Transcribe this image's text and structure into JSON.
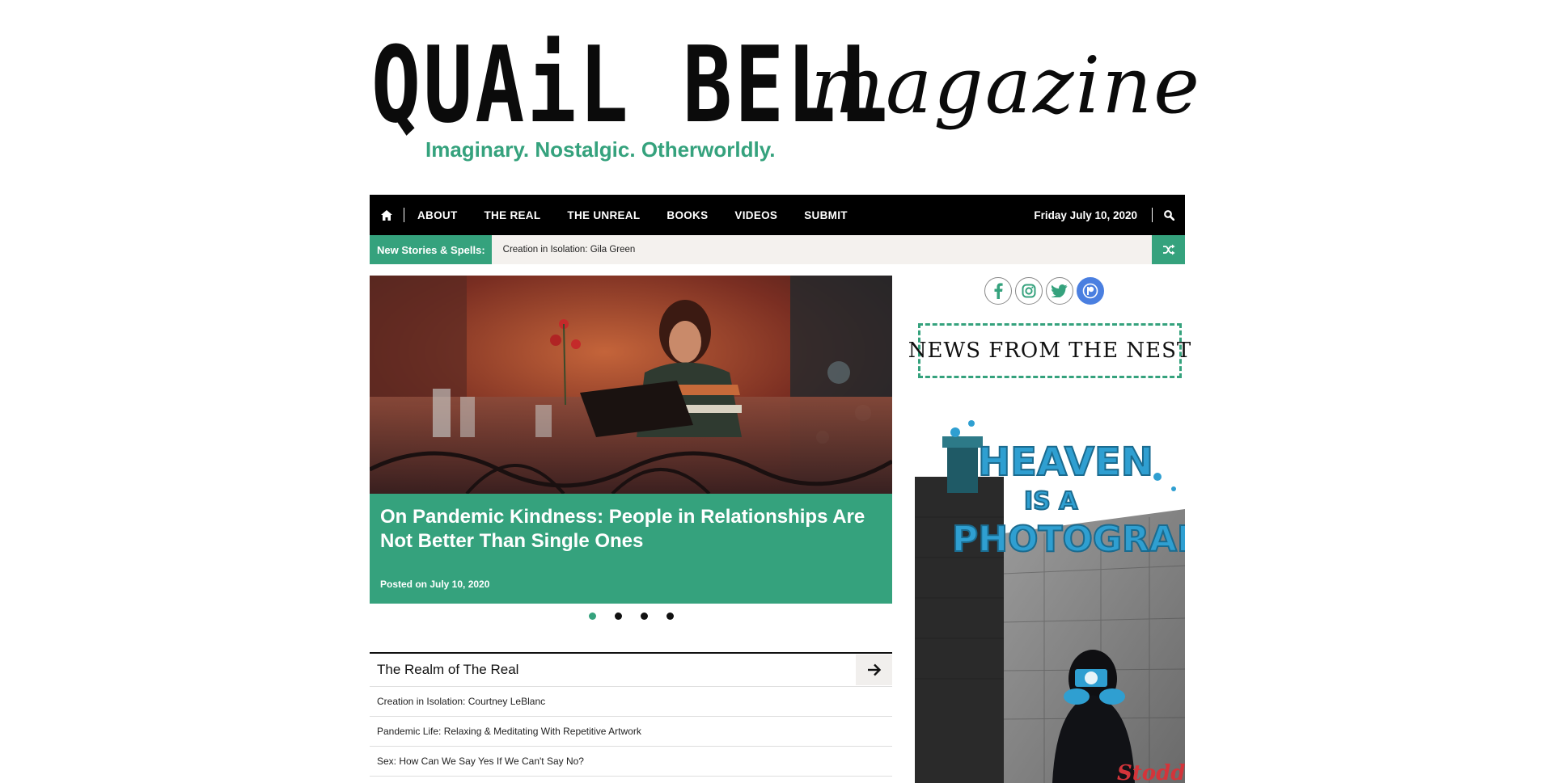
{
  "header": {
    "logo_quail": "QUAiL BELL",
    "logo_magazine": "magazine",
    "tagline": "Imaginary. Nostalgic. Otherworldly."
  },
  "nav": {
    "home_icon": "home-icon",
    "items": [
      "ABOUT",
      "THE REAL",
      "THE UNREAL",
      "BOOKS",
      "VIDEOS",
      "SUBMIT"
    ],
    "date": "Friday July 10, 2020",
    "search_icon": "search-icon"
  },
  "ticker": {
    "label": "New Stories & Spells:",
    "text": "Creation in Isolation: Gila Green",
    "shuffle_icon": "shuffle-icon"
  },
  "featured": {
    "title": "On Pandemic Kindness: People in Relationships Are Not Better Than Single Ones",
    "date": "Posted on July 10, 2020",
    "active_slide": 1,
    "slide_count": 4
  },
  "realm": {
    "title": "The Realm of The Real",
    "items": [
      "Creation in Isolation: Courtney LeBlanc",
      "Pandemic Life: Relaxing & Meditating With Repetitive Artwork",
      "Sex: How Can We Say Yes If We Can't Say No?"
    ]
  },
  "sidebar": {
    "social": [
      "facebook-icon",
      "instagram-icon",
      "twitter-icon",
      "patreon-icon"
    ],
    "nest_title": "NEWS FROM THE NEST",
    "ad_title_line1": "HEAVEN",
    "ad_title_line2": "IS A",
    "ad_title_line3": "PHOTOGRAPH",
    "ad_author": "Stoddard"
  },
  "colors": {
    "accent": "#35a27d",
    "nav_bg": "#000000",
    "ticker_bg": "#f4f1ee",
    "patreon": "#4a7fe0"
  }
}
